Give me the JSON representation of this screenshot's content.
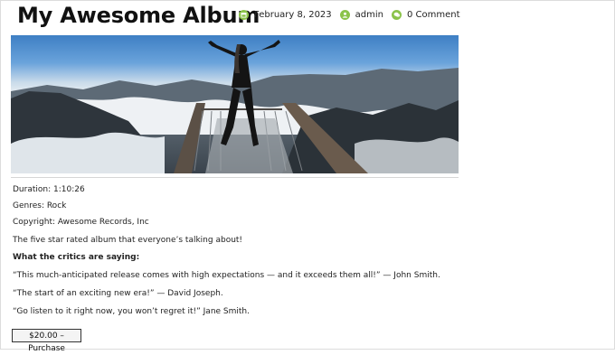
{
  "post": {
    "title": "My Awesome Album",
    "meta": {
      "date": "February 8, 2023",
      "author": "admin",
      "comments": "0 Comment"
    }
  },
  "hero": {
    "image_alt": "Person with raised arms standing on a mountain viewpoint platform above clouds"
  },
  "details": {
    "duration": "Duration: 1:10:26",
    "genres": "Genres: Rock",
    "copyright": "Copyright: Awesome Records, Inc"
  },
  "description": "The five star rated album that everyone’s talking about!",
  "critics_heading": "What the critics are saying:",
  "critics": [
    "“This much-anticipated release comes with high expectations — and it exceeds them all!” — John Smith.",
    "“The start of an exciting new era!” — David Joseph.",
    "“Go listen to it right now, you won’t regret it!” Jane Smith."
  ],
  "purchase": {
    "label": "$20.00 – Purchase"
  },
  "colors": {
    "meta_icon": "#8bc34a"
  },
  "icons": {
    "date": "calendar-icon",
    "author": "user-icon",
    "comments": "comment-icon"
  }
}
